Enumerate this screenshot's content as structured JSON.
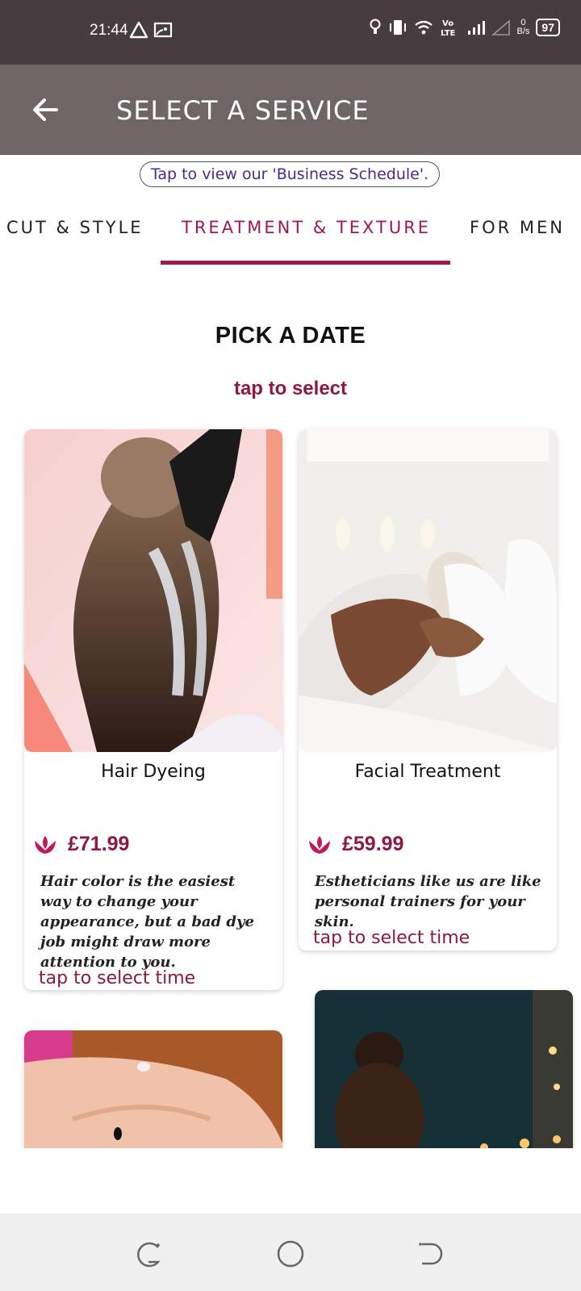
{
  "status": {
    "time": "21:44",
    "net_speed_value": "0",
    "net_speed_unit": "B/s",
    "battery": "97",
    "icons": [
      "alert-triangle-icon",
      "screen-cast-icon",
      "bulb-icon",
      "vibrate-icon",
      "wifi-icon",
      "volte-icon",
      "signal-icon",
      "signal-empty-icon",
      "battery-icon"
    ]
  },
  "app_bar": {
    "title": "SELECT A SERVICE",
    "back_icon": "arrow-left-icon"
  },
  "schedule_link": "Tap to view our 'Business Schedule'.",
  "tabs": [
    {
      "label": "CUT & STYLE",
      "active": false
    },
    {
      "label": "TREATMENT & TEXTURE",
      "active": true
    },
    {
      "label": "FOR MEN",
      "active": false
    }
  ],
  "pick_title": "PICK A DATE",
  "pick_subtitle": "tap to select",
  "services": [
    {
      "name": "Hair Dyeing",
      "price": "£71.99",
      "description": "Hair color is the easiest way to change your appearance, but a bad dye job might draw more attention to you.",
      "cta": "tap to select time",
      "image": "hair-dyeing-photo"
    },
    {
      "name": "Facial Treatment",
      "price": "£59.99",
      "description": "Estheticians like us are like personal trainers for your skin.",
      "cta": "tap to select time",
      "image": "facial-treatment-photo"
    },
    {
      "image": "nail-manicure-photo"
    },
    {
      "image": "spa-candles-photo"
    }
  ],
  "nav": [
    "recents-icon",
    "home-icon",
    "back-icon"
  ],
  "colors": {
    "status_bar": "#473c3f",
    "app_bar": "#6f6566",
    "accent": "#a0184f",
    "price": "#8e1745"
  }
}
